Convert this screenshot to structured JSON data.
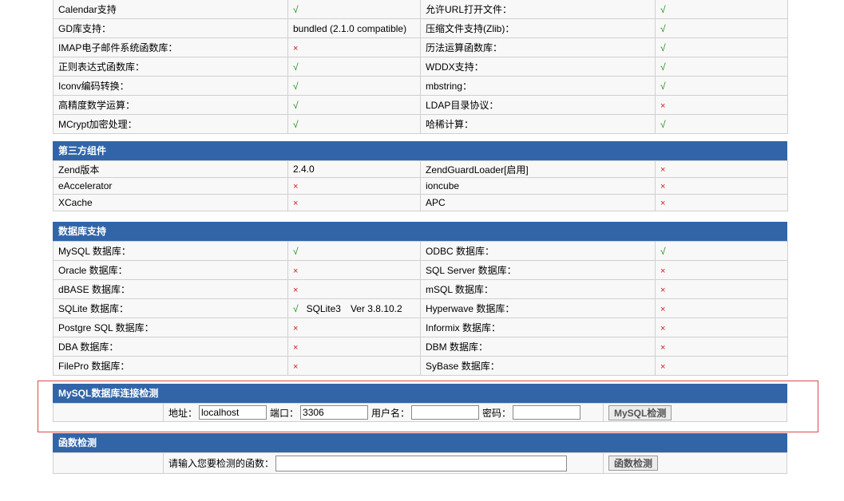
{
  "marks": {
    "ok": "√",
    "no": "×"
  },
  "colors": {
    "header_bg": "#3165a8",
    "ok": "#1a8c1a",
    "no": "#d21a1a",
    "highlight": "#d84a4a"
  },
  "general": {
    "rows": [
      {
        "l_label": "Calendar支持",
        "l_value": "√",
        "r_label": "允许URL打开文件：",
        "r_value": "√"
      },
      {
        "l_label": "GD库支持：",
        "l_value": "bundled (2.1.0 compatible)",
        "r_label": "压缩文件支持(Zlib)：",
        "r_value": "√"
      },
      {
        "l_label": "IMAP电子邮件系统函数库：",
        "l_value": "×",
        "r_label": "历法运算函数库：",
        "r_value": "√"
      },
      {
        "l_label": "正则表达式函数库：",
        "l_value": "√",
        "r_label": "WDDX支持：",
        "r_value": "√"
      },
      {
        "l_label": "Iconv编码转换：",
        "l_value": "√",
        "r_label": "mbstring：",
        "r_value": "√"
      },
      {
        "l_label": "高精度数学运算：",
        "l_value": "√",
        "r_label": "LDAP目录协议：",
        "r_value": "×"
      },
      {
        "l_label": "MCrypt加密处理：",
        "l_value": "√",
        "r_label": "哈稀计算：",
        "r_value": "√"
      }
    ]
  },
  "third_party": {
    "title": "第三方组件",
    "rows": [
      {
        "l_label": "Zend版本",
        "l_value": "2.4.0",
        "r_label": "ZendGuardLoader[启用]",
        "r_value": "×"
      },
      {
        "l_label": "eAccelerator",
        "l_value": "×",
        "r_label": "ioncube",
        "r_value": "×"
      },
      {
        "l_label": "XCache",
        "l_value": "×",
        "r_label": "APC",
        "r_value": "×"
      }
    ]
  },
  "database": {
    "title": "数据库支持",
    "rows": [
      {
        "l_label": "MySQL 数据库：",
        "l_value": "√",
        "r_label": "ODBC 数据库：",
        "r_value": "√"
      },
      {
        "l_label": "Oracle 数据库：",
        "l_value": "×",
        "r_label": "SQL Server 数据库：",
        "r_value": "×"
      },
      {
        "l_label": "dBASE 数据库：",
        "l_value": "×",
        "r_label": "mSQL 数据库：",
        "r_value": "×"
      },
      {
        "l_label": "SQLite 数据库：",
        "l_value": "√",
        "l_extra": "SQLite3",
        "l_extra2": "Ver 3.8.10.2",
        "r_label": "Hyperwave 数据库：",
        "r_value": "×"
      },
      {
        "l_label": "Postgre SQL 数据库：",
        "l_value": "×",
        "r_label": "Informix 数据库：",
        "r_value": "×"
      },
      {
        "l_label": "DBA 数据库：",
        "l_value": "×",
        "r_label": "DBM 数据库：",
        "r_value": "×"
      },
      {
        "l_label": "FilePro 数据库：",
        "l_value": "×",
        "r_label": "SyBase 数据库：",
        "r_value": "×"
      }
    ]
  },
  "mysql_check": {
    "title": "MySQL数据库连接检测",
    "host_label": "地址：",
    "host_value": "localhost",
    "port_label": "端口：",
    "port_value": "3306",
    "user_label": "用户名：",
    "user_value": "",
    "pass_label": "密码：",
    "pass_value": "",
    "button": "MySQL检测"
  },
  "func_check": {
    "title": "函数检测",
    "prompt": "请输入您要检测的函数：",
    "value": "",
    "button": "函数检测"
  }
}
